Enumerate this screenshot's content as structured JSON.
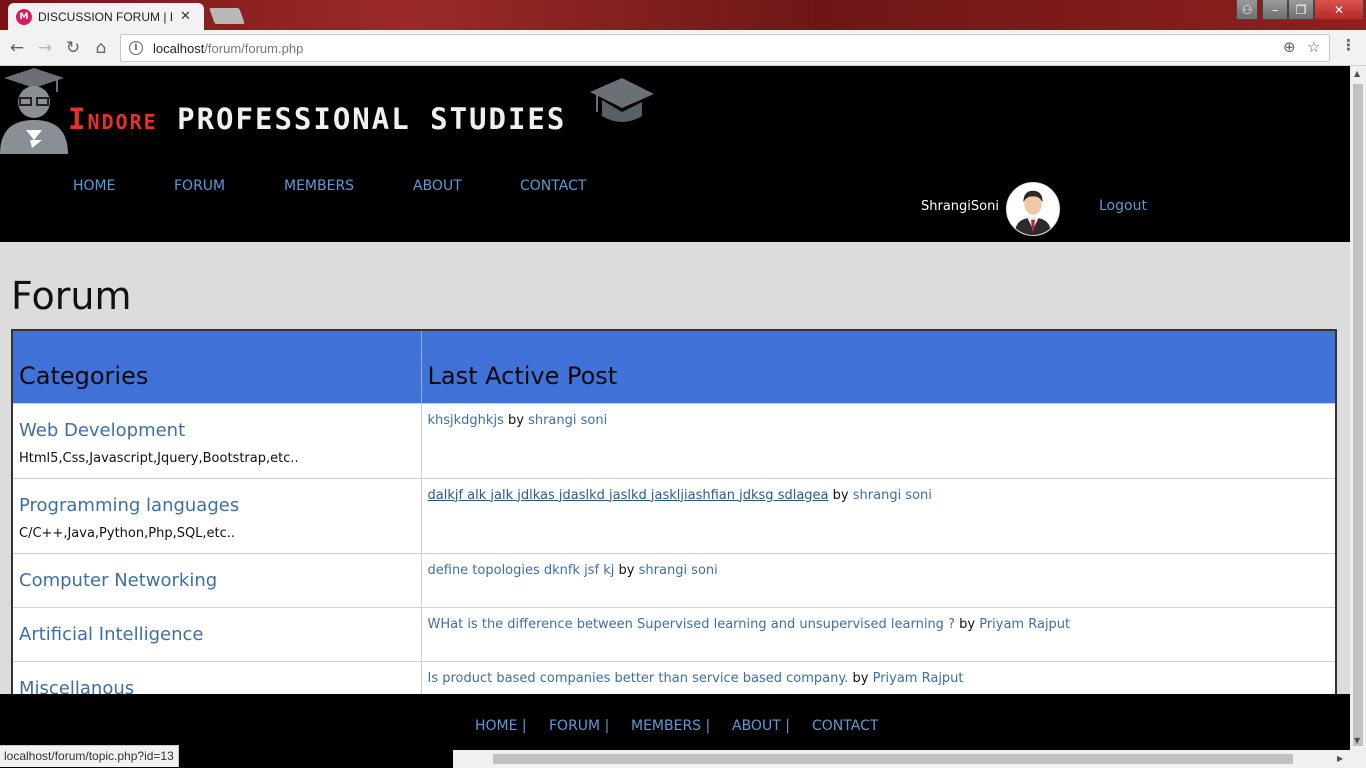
{
  "browser": {
    "tab_title": "DISCUSSION FORUM | IN",
    "tab_icon": "forum-favicon-icon",
    "url_host": "localhost",
    "url_path": "/forum/forum.php"
  },
  "header": {
    "logo_word1": "Indore",
    "logo_word2": "PROFESSIONAL STUDIES",
    "nav": [
      "HOME",
      "FORUM",
      "MEMBERS",
      "ABOUT",
      "CONTACT"
    ],
    "username": "ShrangiSoni",
    "logout": "Logout"
  },
  "page_title": "Forum",
  "table": {
    "headers": [
      "Categories",
      "Last Active Post"
    ],
    "by_label": "by",
    "rows": [
      {
        "category": "Web Development",
        "description": "Html5,Css,Javascript,Jquery,Bootstrap,etc..",
        "post": "khsjkdghkjs",
        "author": "shrangi soni"
      },
      {
        "category": "Programming languages",
        "description": "C/C++,Java,Python,Php,SQL,etc..",
        "post": "dalkjf alk jalk jdlkas jdaslkd jaslkd jaskljiashfian jdksg sdlagea",
        "author": "shrangi soni"
      },
      {
        "category": "Computer Networking",
        "description": "",
        "post": "define topologies dknfk jsf kj",
        "author": "shrangi soni"
      },
      {
        "category": "Artificial Intelligence",
        "description": "",
        "post": "WHat is the difference between Supervised learning and unsupervised learning ?",
        "author": "Priyam Rajput"
      },
      {
        "category": "Miscellanous",
        "description": "",
        "post": "Is product based companies better than service based company.",
        "author": "Priyam Rajput"
      }
    ]
  },
  "footer": {
    "links": [
      "HOME |",
      "FORUM |",
      "MEMBERS |",
      "ABOUT |",
      "CONTACT"
    ]
  },
  "status_bar": "localhost/forum/topic.php?id=13",
  "colors": {
    "header_bg": "#000000",
    "nav_link": "#5b9bd5",
    "table_header": "#4172d8",
    "link": "#3d6fa6",
    "logo_red": "#e3322c"
  }
}
